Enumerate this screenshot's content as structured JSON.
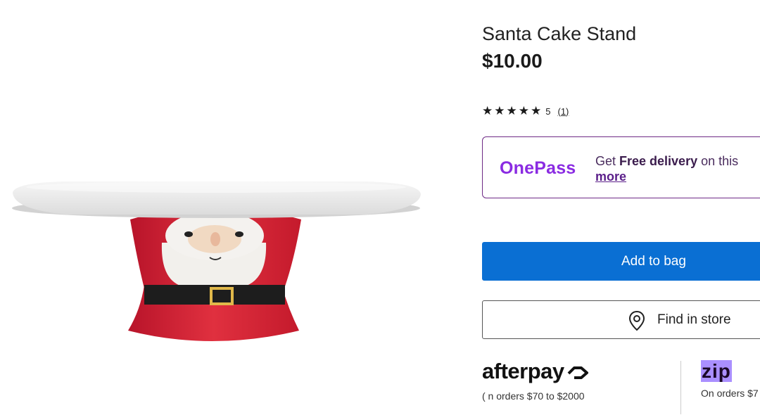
{
  "product": {
    "title": "Santa Cake Stand",
    "price": "$10.00",
    "image_alt": "Santa cake stand product photo"
  },
  "rating": {
    "stars": 5,
    "score": "5",
    "review_count": "(1)"
  },
  "onepass": {
    "logo": "OnePass",
    "text_prefix": "Get ",
    "text_bold": "Free delivery",
    "text_suffix": " on this",
    "link_label": "more",
    "color": "#8a2be2"
  },
  "actions": {
    "add_to_bag": "Add to bag",
    "find_in_store": "Find in store",
    "primary_color": "#0a6fd3"
  },
  "payments": {
    "afterpay_logo": "afterpay",
    "afterpay_note": "( n orders $70 to $2000",
    "zip_logo": "zip",
    "zip_note": "On orders $7"
  }
}
